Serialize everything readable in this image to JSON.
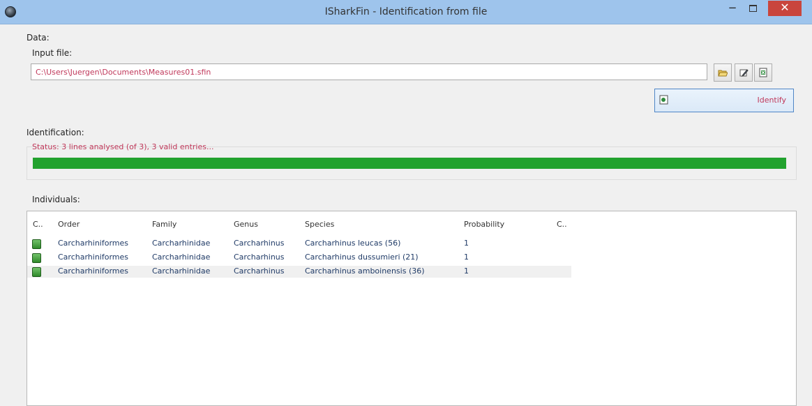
{
  "window": {
    "title": "ISharkFin - Identification from file",
    "minimize": "−",
    "close": "✕"
  },
  "data_section": {
    "label": "Data:",
    "input_label": "Input file:",
    "input_value": "C:\\Users\\Juergen\\Documents\\Measures01.sfin",
    "buttons": [
      {
        "icon": "folder-open-icon"
      },
      {
        "icon": "edit-icon"
      },
      {
        "icon": "excel-icon"
      }
    ],
    "identify_label": "Identify",
    "identify_icon": "identify-icon"
  },
  "identification": {
    "label": "Identification:",
    "status": "Status:  3 lines analysed (of 3), 3 valid entries...",
    "progress": 1.0,
    "progress_color": "#22a22e"
  },
  "individuals": {
    "label": "Individuals:",
    "columns": [
      "C..",
      "Order",
      "Family",
      "Genus",
      "Species",
      "Probability",
      "C.."
    ],
    "rows": [
      {
        "order": "Carcharhiniformes",
        "family": "Carcharhinidae",
        "genus": "Carcharhinus",
        "species": "Carcharhinus leucas (56)",
        "probability": "1"
      },
      {
        "order": "Carcharhiniformes",
        "family": "Carcharhinidae",
        "genus": "Carcharhinus",
        "species": "Carcharhinus dussumieri (21)",
        "probability": "1"
      },
      {
        "order": "Carcharhiniformes",
        "family": "Carcharhinidae",
        "genus": "Carcharhinus",
        "species": "Carcharhinus amboinensis (36)",
        "probability": "1"
      }
    ]
  }
}
